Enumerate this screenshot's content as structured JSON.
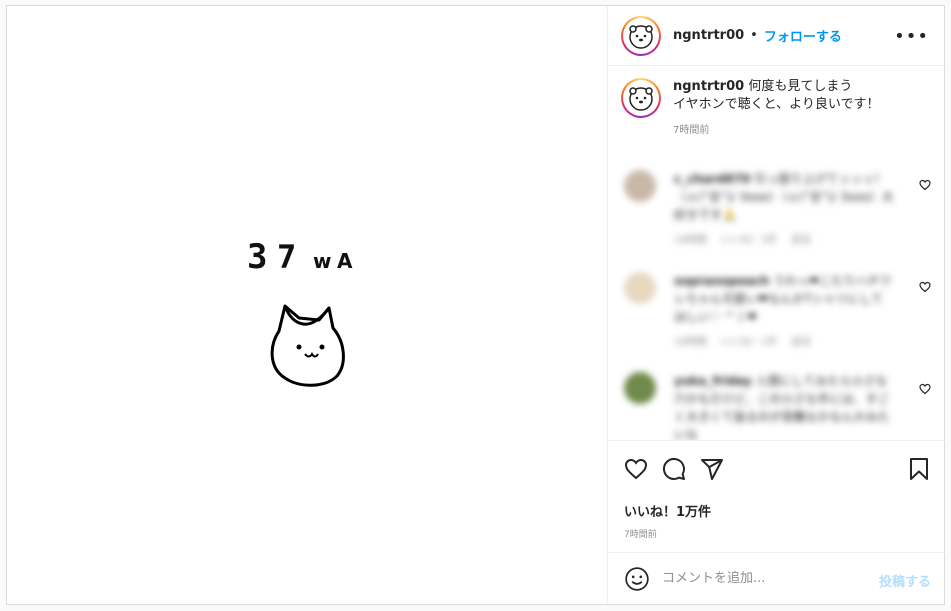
{
  "post": {
    "author": "ngntrtr00",
    "follow_label": "フォローする",
    "separator": "•",
    "more_icon": "more-horizontal-icon",
    "caption_line1": "何度も見てしまう",
    "caption_line2": "イヤホンで聴くと、より良いです！",
    "caption_time": "7時間前",
    "image_text": "37wa"
  },
  "comments": [
    {
      "user": "c_chard870",
      "text": "引っ張り上げてッッッ！（ｏ(°言°)/ 3ooo）（ｏ(°言°)/ 3ooo）大好きです🙏",
      "time": "18時間",
      "likes": "いいね！3件",
      "reply": "返信"
    },
    {
      "user": "sopranopeach",
      "text": "うわっ❤こたりハチワレちゃん可愛い❤なんかTシャツにしてほしい♡ ^ ) ❤",
      "time": "18時間",
      "likes": "いいね！1件",
      "reply": "返信"
    },
    {
      "user": "yuka_friday",
      "text": "人間にしてみたら小さな穴かもだけど、この小さな手には、すごく大きくて抜るのが苦難なかなんかみたいな",
      "time": "",
      "likes": "",
      "reply": ""
    }
  ],
  "actions": {
    "like_icon": "heart-icon",
    "comment_icon": "comment-icon",
    "share_icon": "paper-plane-icon",
    "save_icon": "bookmark-icon",
    "likes_label": "いいね！1万件",
    "post_time": "7時間前"
  },
  "add_comment": {
    "emoji_icon": "emoji-icon",
    "placeholder": "コメントを追加...",
    "post_label": "投稿する"
  },
  "colors": {
    "link": "#0095f6",
    "post_disabled": "#b2dffc",
    "muted": "#8e8e8e"
  }
}
